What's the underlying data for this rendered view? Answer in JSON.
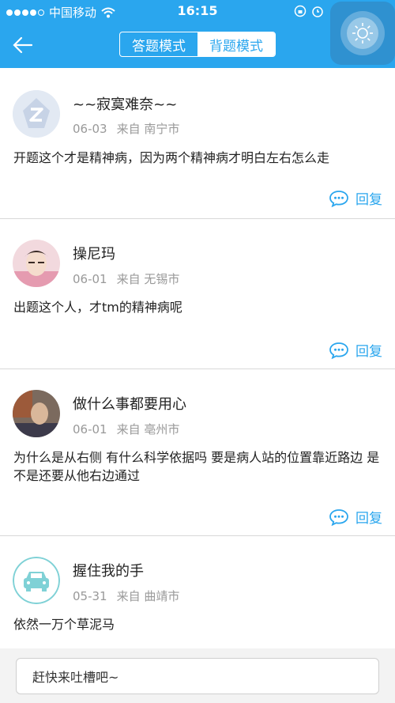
{
  "status_bar": {
    "carrier": "中国移动",
    "time": "16:15"
  },
  "header": {
    "tabs": [
      {
        "label": "答题模式",
        "active": false
      },
      {
        "label": "背题模式",
        "active": true
      }
    ],
    "accent_color": "#2aa6ee"
  },
  "comments": [
    {
      "username": "~~寂寞难奈~~",
      "date": "06-03",
      "source": "来自 南宁市",
      "text": "开题这个才是精神病，因为两个精神病才明白左右怎么走",
      "reply_label": "回复",
      "avatar": "qq-default-avatar"
    },
    {
      "username": "操尼玛",
      "date": "06-01",
      "source": "来自 无锡市",
      "text": "出题这个人，才tm的精神病呢",
      "reply_label": "回复",
      "avatar": "photo-avatar"
    },
    {
      "username": "做什么事都要用心",
      "date": "06-01",
      "source": "来自 亳州市",
      "text": "为什么是从右侧  有什么科学依据吗  要是病人站的位置靠近路边 是不是还要从他右边通过",
      "reply_label": "回复",
      "avatar": "photo-avatar"
    },
    {
      "username": "握住我的手",
      "date": "05-31",
      "source": "来自 曲靖市",
      "text": "依然一万个草泥马",
      "avatar": "car-avatar"
    }
  ],
  "input": {
    "placeholder": "赶快来吐槽吧~"
  }
}
